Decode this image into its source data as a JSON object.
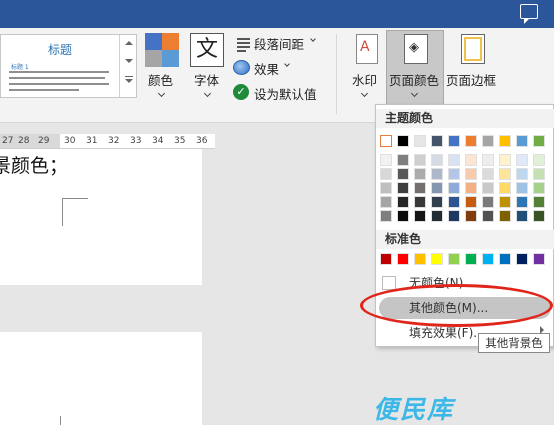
{
  "ribbon": {
    "style_gallery": {
      "heading": "标题",
      "subheading": "标题 1"
    },
    "colors_label": "颜色",
    "fonts_label": "字体",
    "fonts_glyph": "文",
    "paragraph_spacing_label": "段落间距",
    "effects_label": "效果",
    "set_default_label": "设为默认值",
    "watermark_label": "水印",
    "page_color_label": "页面颜色",
    "page_borders_label": "页面边框",
    "theme_colors_accent": [
      "#4472c4",
      "#ed7d31",
      "#a5a5a5",
      "#5b9bd5"
    ]
  },
  "ruler": {
    "numbers": [
      "27",
      "28",
      "29",
      "30",
      "31",
      "32",
      "33",
      "34",
      "35",
      "36"
    ]
  },
  "document": {
    "visible_text": "景颜色；"
  },
  "dropdown": {
    "theme_colors_title": "主题颜色",
    "theme_top_row": [
      "#ffffff",
      "#000000",
      "#e7e6e6",
      "#44546a",
      "#4472c4",
      "#ed7d31",
      "#a5a5a5",
      "#ffc000",
      "#5b9bd5",
      "#70ad47"
    ],
    "theme_shades": [
      [
        "#f2f2f2",
        "#7f7f7f",
        "#d0cece",
        "#d6dce4",
        "#d9e2f3",
        "#fbe5d5",
        "#ededed",
        "#fff2cc",
        "#deebf6",
        "#e2efd9"
      ],
      [
        "#d8d8d8",
        "#595959",
        "#aeabab",
        "#adb9ca",
        "#b4c6e7",
        "#f7cbac",
        "#dbdbdb",
        "#fee599",
        "#bdd7ee",
        "#c5e0b3"
      ],
      [
        "#bfbfbf",
        "#3f3f3f",
        "#757070",
        "#8496b0",
        "#8eaadb",
        "#f4b183",
        "#c9c9c9",
        "#ffd965",
        "#9dc3e6",
        "#a8d08d"
      ],
      [
        "#a5a5a5",
        "#262626",
        "#3a3838",
        "#323f4f",
        "#2f5496",
        "#c55a11",
        "#7b7b7b",
        "#bf9000",
        "#2e75b5",
        "#538135"
      ],
      [
        "#7f7f7f",
        "#0c0c0c",
        "#171616",
        "#222a35",
        "#1e3864",
        "#833c0b",
        "#525252",
        "#7f6000",
        "#1e4e79",
        "#375623"
      ]
    ],
    "standard_colors_title": "标准色",
    "standard_colors": [
      "#c00000",
      "#ff0000",
      "#ffc000",
      "#ffff00",
      "#92d050",
      "#00b050",
      "#00b0f0",
      "#0070c0",
      "#002060",
      "#7030a0"
    ],
    "no_color_label": "无颜色(N)",
    "more_colors_label": "其他颜色(M)...",
    "fill_effects_label": "填充效果(F)...",
    "tooltip": "其他背景色"
  },
  "watermark_text": "便民库",
  "highlight_color": "#e0261a"
}
